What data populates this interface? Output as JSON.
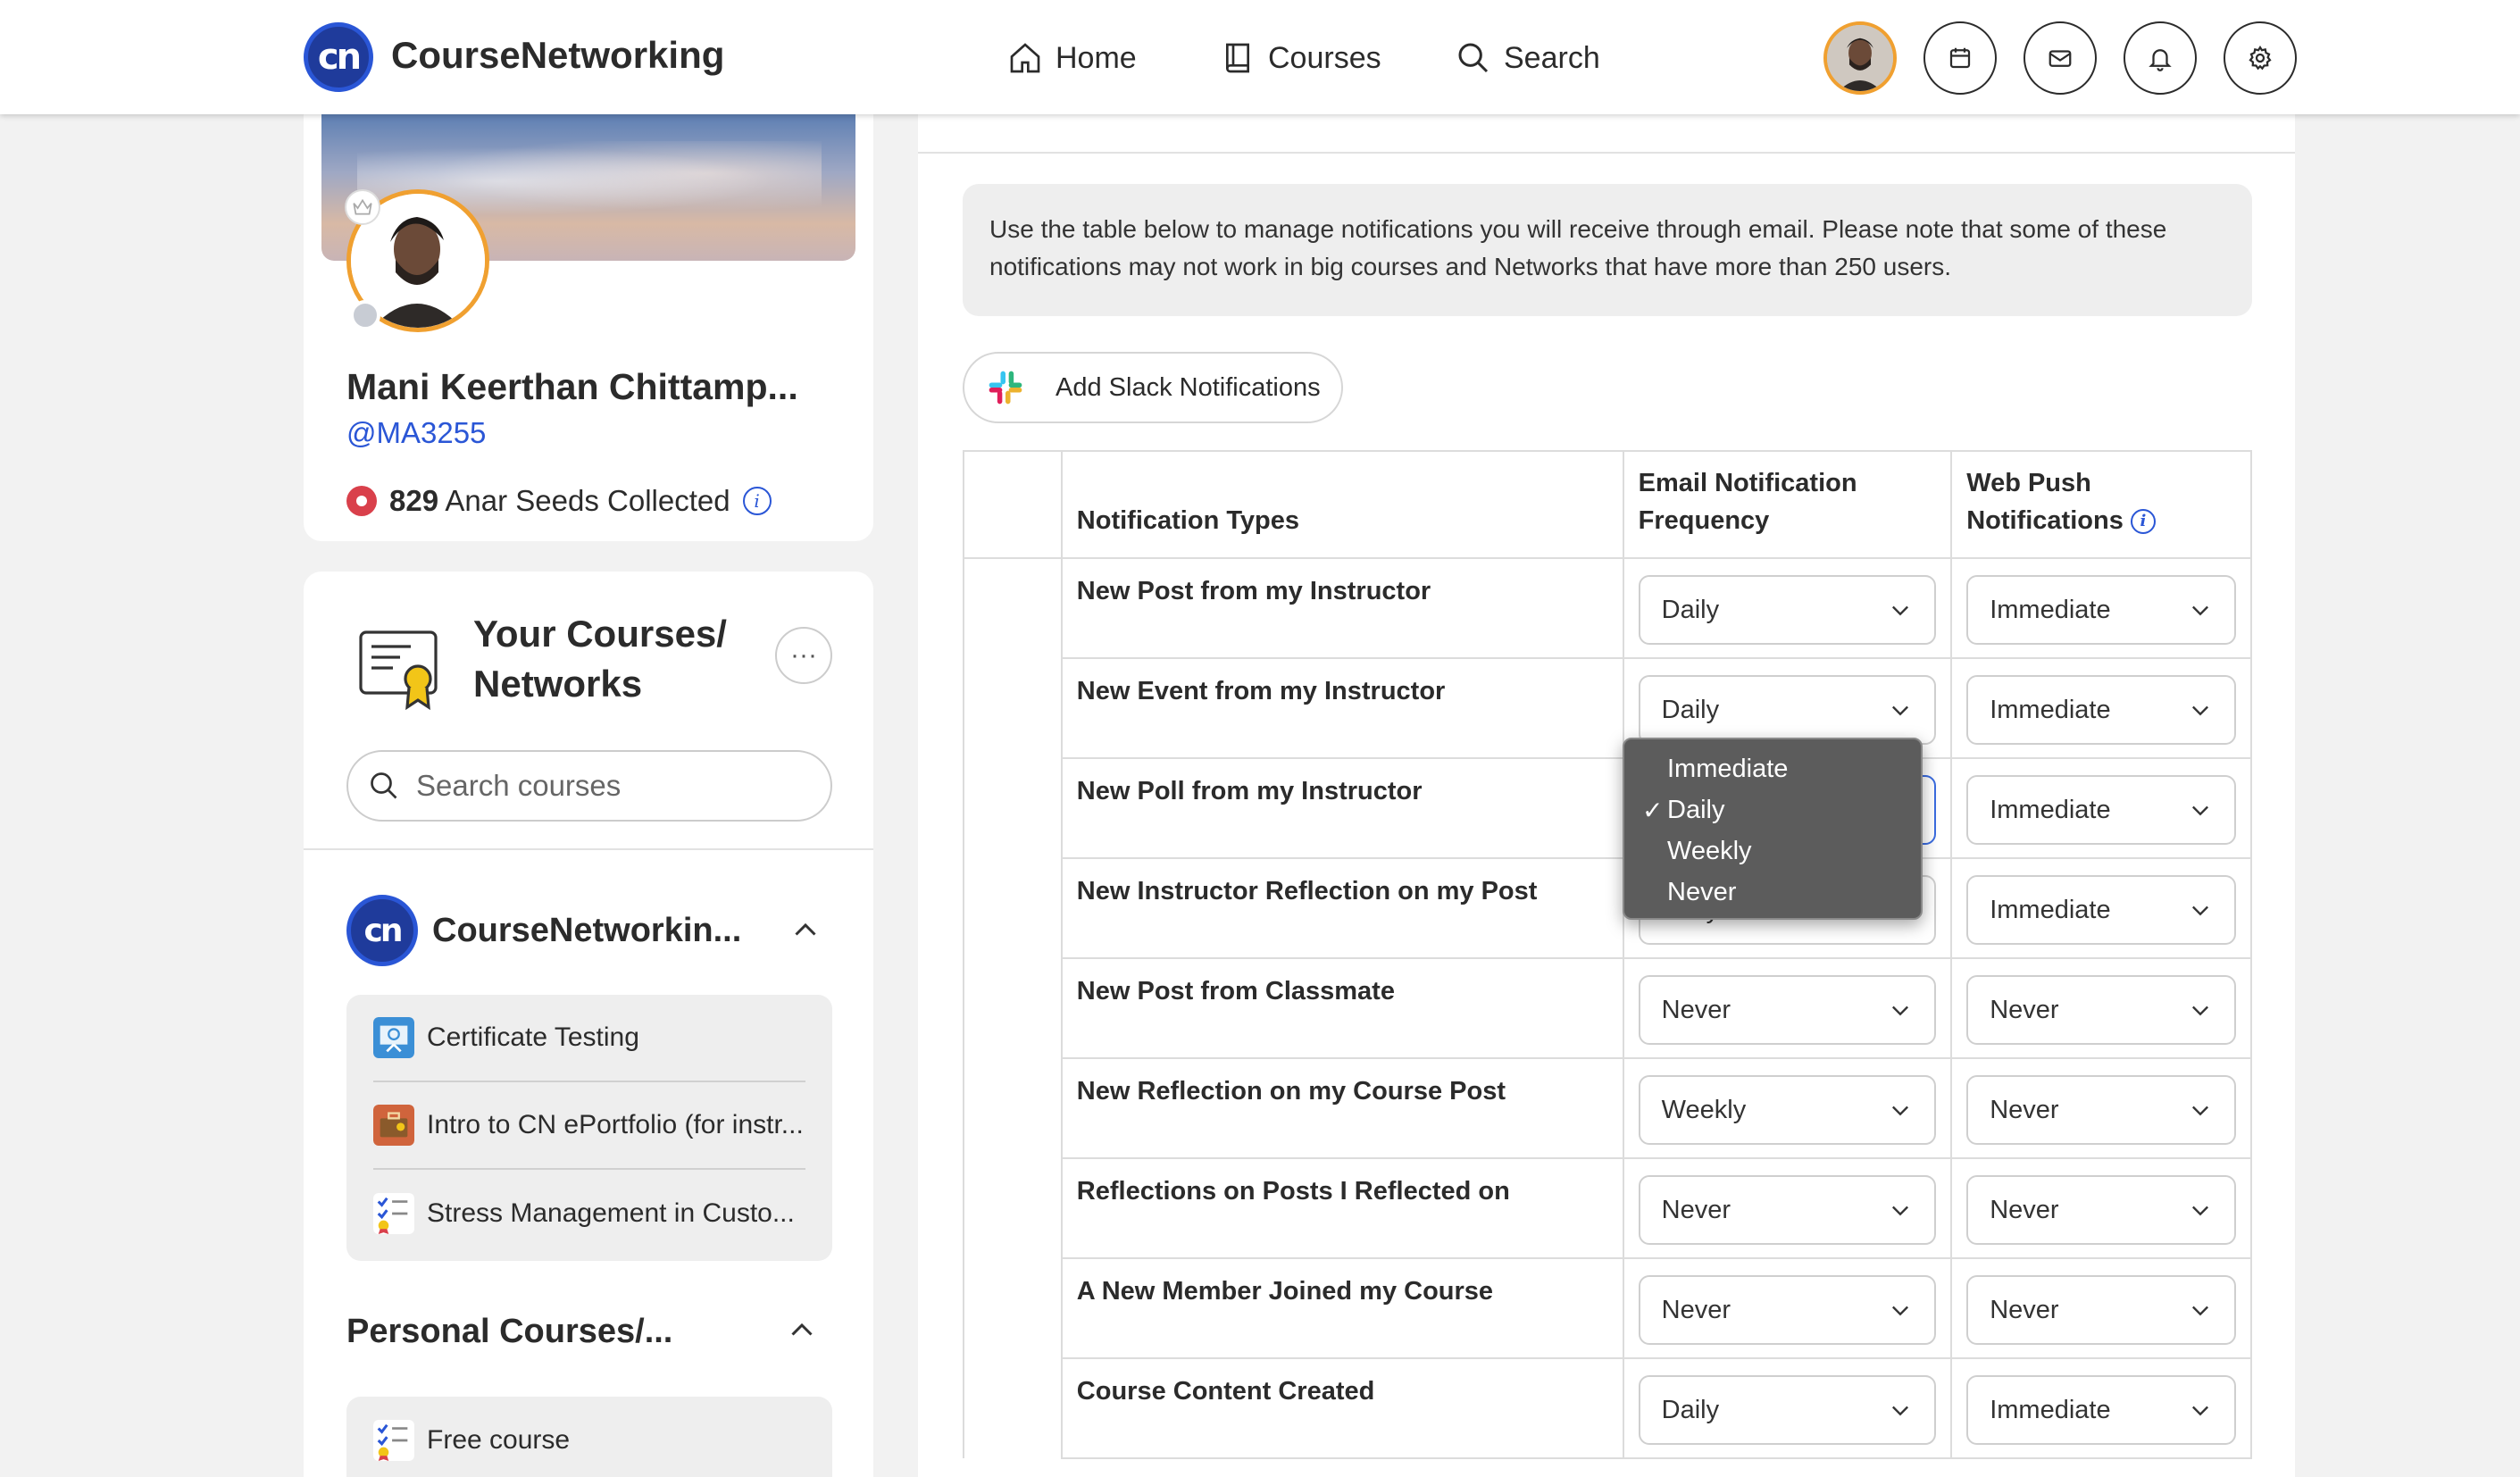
{
  "brand": {
    "name": "CourseNetworking",
    "logo_text": "cn"
  },
  "nav": {
    "home": "Home",
    "courses": "Courses",
    "search": "Search"
  },
  "top_icons": [
    "avatar",
    "calendar-icon",
    "mail-icon",
    "bell-icon",
    "gear-icon"
  ],
  "profile": {
    "name": "Mani Keerthan Chittamp...",
    "handle": "@MA3255",
    "seeds_count": "829",
    "seeds_label": "Anar Seeds Collected"
  },
  "courses_panel": {
    "title_line1": "Your Courses/",
    "title_line2": "Networks",
    "more": "···",
    "search_placeholder": "Search courses",
    "network_name": "CourseNetworkin...",
    "network_logo": "cn",
    "courses": [
      {
        "name": "Certificate Testing",
        "color": "#3b8fd6"
      },
      {
        "name": "Intro to CN ePortfolio (for instr...",
        "color": "#d0643c"
      },
      {
        "name": "Stress Management in Custo...",
        "color": "#ffffff"
      }
    ],
    "personal_title": "Personal Courses/...",
    "personal_courses": [
      {
        "name": "Free course",
        "color": "#ffffff"
      }
    ]
  },
  "settings": {
    "note": "Use the table below to manage notifications you will receive through email. Please note that some of these notifications may not work in big courses and Networks that have more than 250 users.",
    "slack_button": "Add Slack Notifications",
    "table_headers": {
      "types": "Notification Types",
      "email_line1": "Email Notification",
      "email_line2": "Frequency",
      "push_line1": "Web Push",
      "push_line2": "Notifications"
    },
    "rows": [
      {
        "type": "New Post from my Instructor",
        "email": "Daily",
        "push": "Immediate"
      },
      {
        "type": "New Event from my Instructor",
        "email": "Daily",
        "push": "Immediate"
      },
      {
        "type": "New Poll from my Instructor",
        "email": "Daily",
        "push": "Immediate"
      },
      {
        "type": "New Instructor Reflection on my Post",
        "email": "Daily",
        "push": "Immediate"
      },
      {
        "type": "New Post from Classmate",
        "email": "Never",
        "push": "Never"
      },
      {
        "type": "New Reflection on my Course Post",
        "email": "Weekly",
        "push": "Never"
      },
      {
        "type": "Reflections on Posts I Reflected on",
        "email": "Never",
        "push": "Never"
      },
      {
        "type": "A New Member Joined my Course",
        "email": "Never",
        "push": "Never"
      },
      {
        "type": "Course Content Created",
        "email": "Daily",
        "push": "Immediate"
      }
    ],
    "dropdown": {
      "options": [
        "Immediate",
        "Daily",
        "Weekly",
        "Never"
      ],
      "selected": "Daily",
      "check": "✓"
    }
  },
  "colors": {
    "accent": "#2a56d6",
    "brand_dark": "#1f3b9b",
    "avatar_ring": "#f0a030",
    "dropdown_bg": "#5c5c5c"
  }
}
